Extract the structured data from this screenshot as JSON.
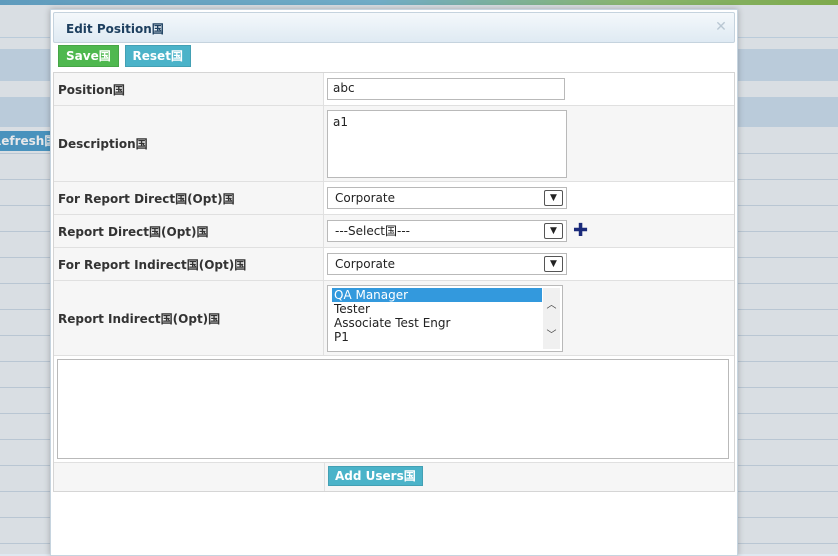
{
  "background": {
    "refresh_label": "Refresh国"
  },
  "dialog": {
    "title": "Edit Position国",
    "close_symbol": "✕"
  },
  "toolbar": {
    "save_label": "Save国",
    "reset_label": "Reset国"
  },
  "form": {
    "position": {
      "label": "Position国",
      "value": "abc"
    },
    "description": {
      "label": "Description国",
      "value": "a1"
    },
    "for_report_direct": {
      "label": "For Report Direct国(Opt)国",
      "value": "Corporate"
    },
    "report_direct": {
      "label": "Report Direct国(Opt)国",
      "value": "---Select国---",
      "add_symbol": "✚"
    },
    "for_report_indirect": {
      "label": "For Report Indirect国(Opt)国",
      "value": "Corporate"
    },
    "report_indirect": {
      "label": "Report Indirect国(Opt)国",
      "options": [
        "QA Manager",
        "Tester",
        "Associate Test Engr",
        "P1"
      ],
      "selected": "QA Manager"
    },
    "users_area": {
      "value": ""
    },
    "add_users_label": "Add Users国"
  },
  "colors": {
    "save": "#4fb84f",
    "reset": "#4bb3c9",
    "selected_option": "#3399dd",
    "title_text": "#1d3f5f"
  }
}
